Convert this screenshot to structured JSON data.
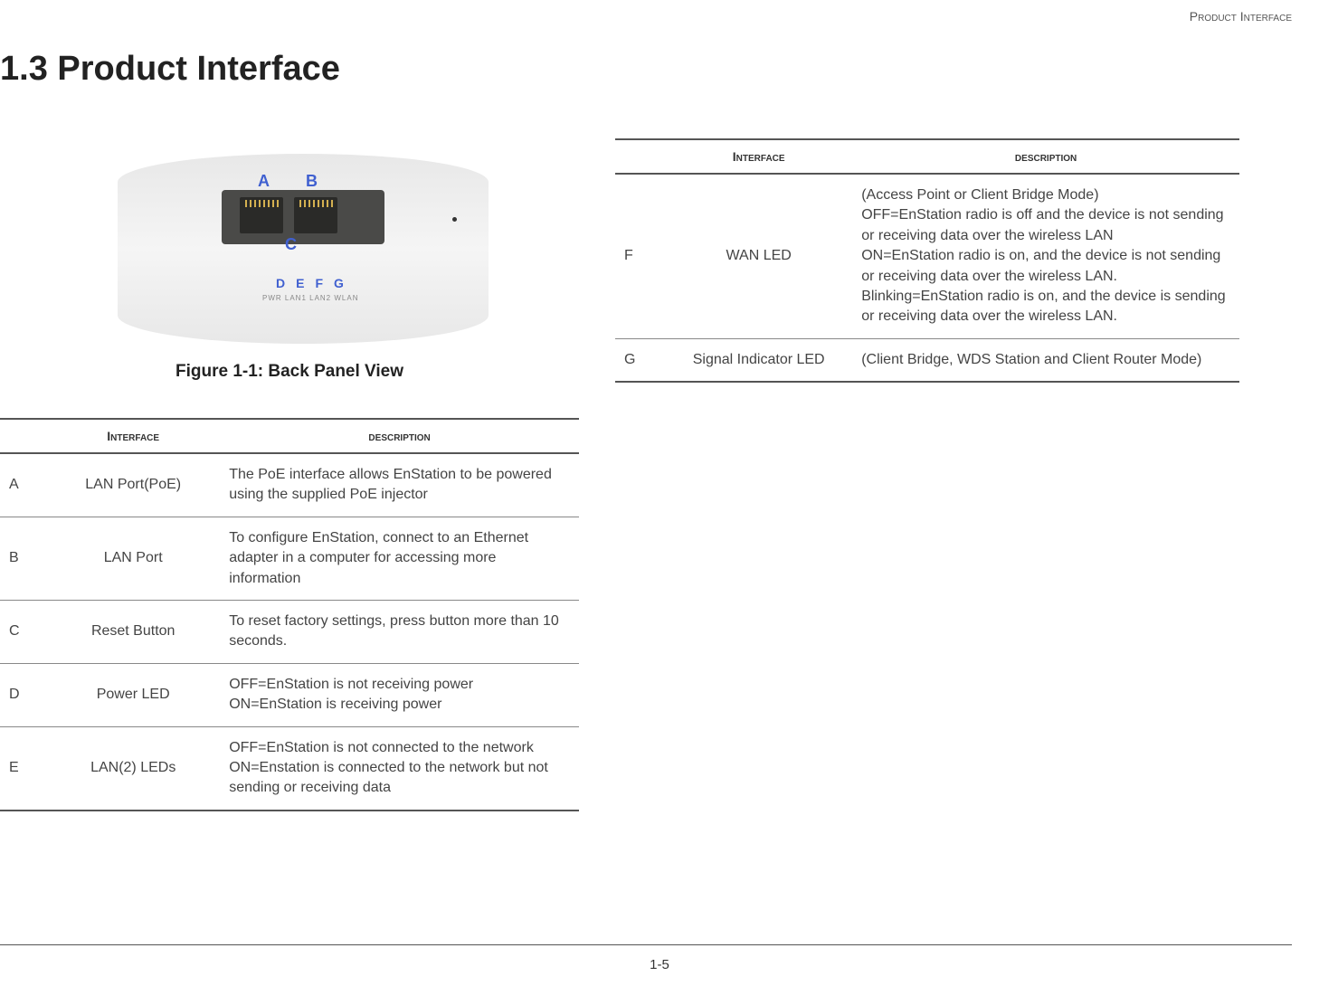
{
  "header": {
    "right_text": "Product Interface"
  },
  "title": "1.3 Product Interface",
  "figure": {
    "labels": {
      "a": "A",
      "b": "B",
      "c": "C",
      "d": "D",
      "e": "E",
      "f": "F",
      "g": "G"
    },
    "led_text": "PWR  LAN1  LAN2  WLAN",
    "caption": "Figure 1-1: Back Panel View"
  },
  "table_headers": {
    "interface": "Interface",
    "description": "description"
  },
  "left_table": [
    {
      "letter": "A",
      "interface": "LAN Port(PoE)",
      "description": "The PoE interface allows EnStation to be powered using the supplied PoE injector"
    },
    {
      "letter": "B",
      "interface": "LAN Port",
      "description": "To configure EnStation, connect to an Ethernet adapter in a computer for accessing more information"
    },
    {
      "letter": "C",
      "interface": "Reset Button",
      "description": "To reset factory settings, press button more than 10 seconds."
    },
    {
      "letter": "D",
      "interface": "Power LED",
      "description": "OFF=EnStation is not receiving power\nON=EnStation is receiving power"
    },
    {
      "letter": "E",
      "interface": "LAN(2) LEDs",
      "description": "OFF=EnStation is not connected to the network\nON=Enstation is connected to the network but not sending or receiving data"
    }
  ],
  "right_table": [
    {
      "letter": "F",
      "interface": "WAN LED",
      "description": "(Access Point or Client Bridge Mode)\nOFF=EnStation radio is off and the device is not sending or receiving data over the wireless LAN\nON=EnStation radio is on, and the device is not sending or receiving data over the wireless LAN.\nBlinking=EnStation radio is on, and the device is sending or receiving data over the wireless LAN."
    },
    {
      "letter": "G",
      "interface": "Signal Indicator LED",
      "description": "(Client Bridge, WDS Station and Client Router Mode)"
    }
  ],
  "page_number": "1-5"
}
